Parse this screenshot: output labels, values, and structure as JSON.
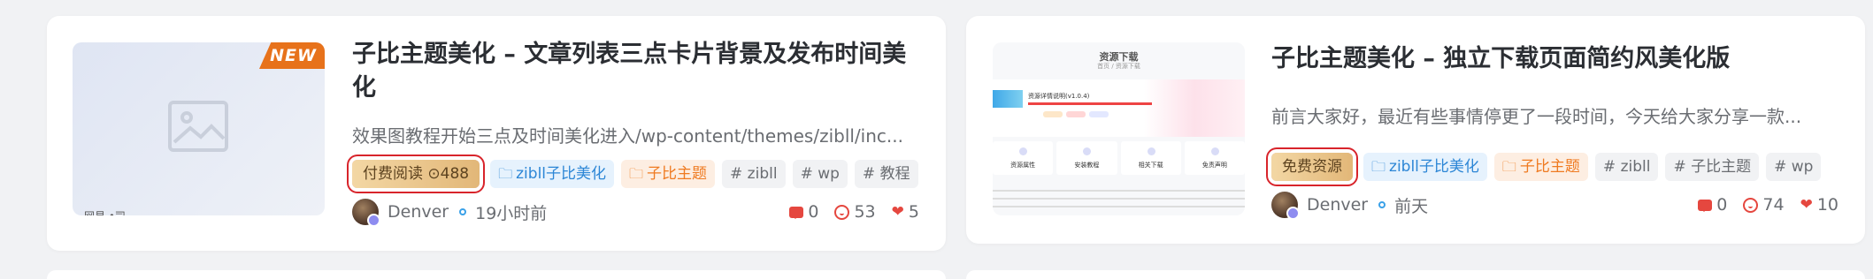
{
  "posts": [
    {
      "badge": "NEW",
      "thumb_caption": "网易 •司",
      "title": "子比主题美化 – 文章列表三点卡片背景及发布时间美化",
      "excerpt": "效果图教程开始三点及时间美化进入/wp-content/themes/zibll/inc...",
      "pay_tag": "付费阅读 ⊙488",
      "tags": [
        {
          "label": "zibll子比美化",
          "style": "blue",
          "icon": "folder-icon"
        },
        {
          "label": "子比主题",
          "style": "orange",
          "icon": "folder-icon"
        },
        {
          "label": "# zibll",
          "style": "plain"
        },
        {
          "label": "# wp",
          "style": "plain"
        },
        {
          "label": "# 教程",
          "style": "plain"
        }
      ],
      "author": "Denver",
      "time": "19小时前",
      "comments": "0",
      "views": "53",
      "likes": "5"
    },
    {
      "thumb": {
        "title": "资源下载",
        "subtitle": "首页 / 资源下载",
        "hero_line": "资源详情说明(v1.0.4)",
        "boxes": [
          "资源属性",
          "安装教程",
          "相关下载",
          "免责声明"
        ]
      },
      "title": "子比主题美化 – 独立下载页面简约风美化版",
      "excerpt": "前言大家好，最近有些事情停更了一段时间，今天给大家分享一款...",
      "pay_tag": "免费资源",
      "tags": [
        {
          "label": "zibll子比美化",
          "style": "blue",
          "icon": "folder-icon"
        },
        {
          "label": "子比主题",
          "style": "orange",
          "icon": "folder-icon"
        },
        {
          "label": "# zibll",
          "style": "plain"
        },
        {
          "label": "# 子比主题",
          "style": "plain"
        },
        {
          "label": "# wp",
          "style": "plain"
        }
      ],
      "author": "Denver",
      "time": "前天",
      "comments": "0",
      "views": "74",
      "likes": "10"
    }
  ],
  "colors": {
    "accent_blue": "#2c86d6",
    "accent_orange": "#ef7a20",
    "highlight_red": "#d8242b",
    "icon_red": "#e5473f"
  }
}
